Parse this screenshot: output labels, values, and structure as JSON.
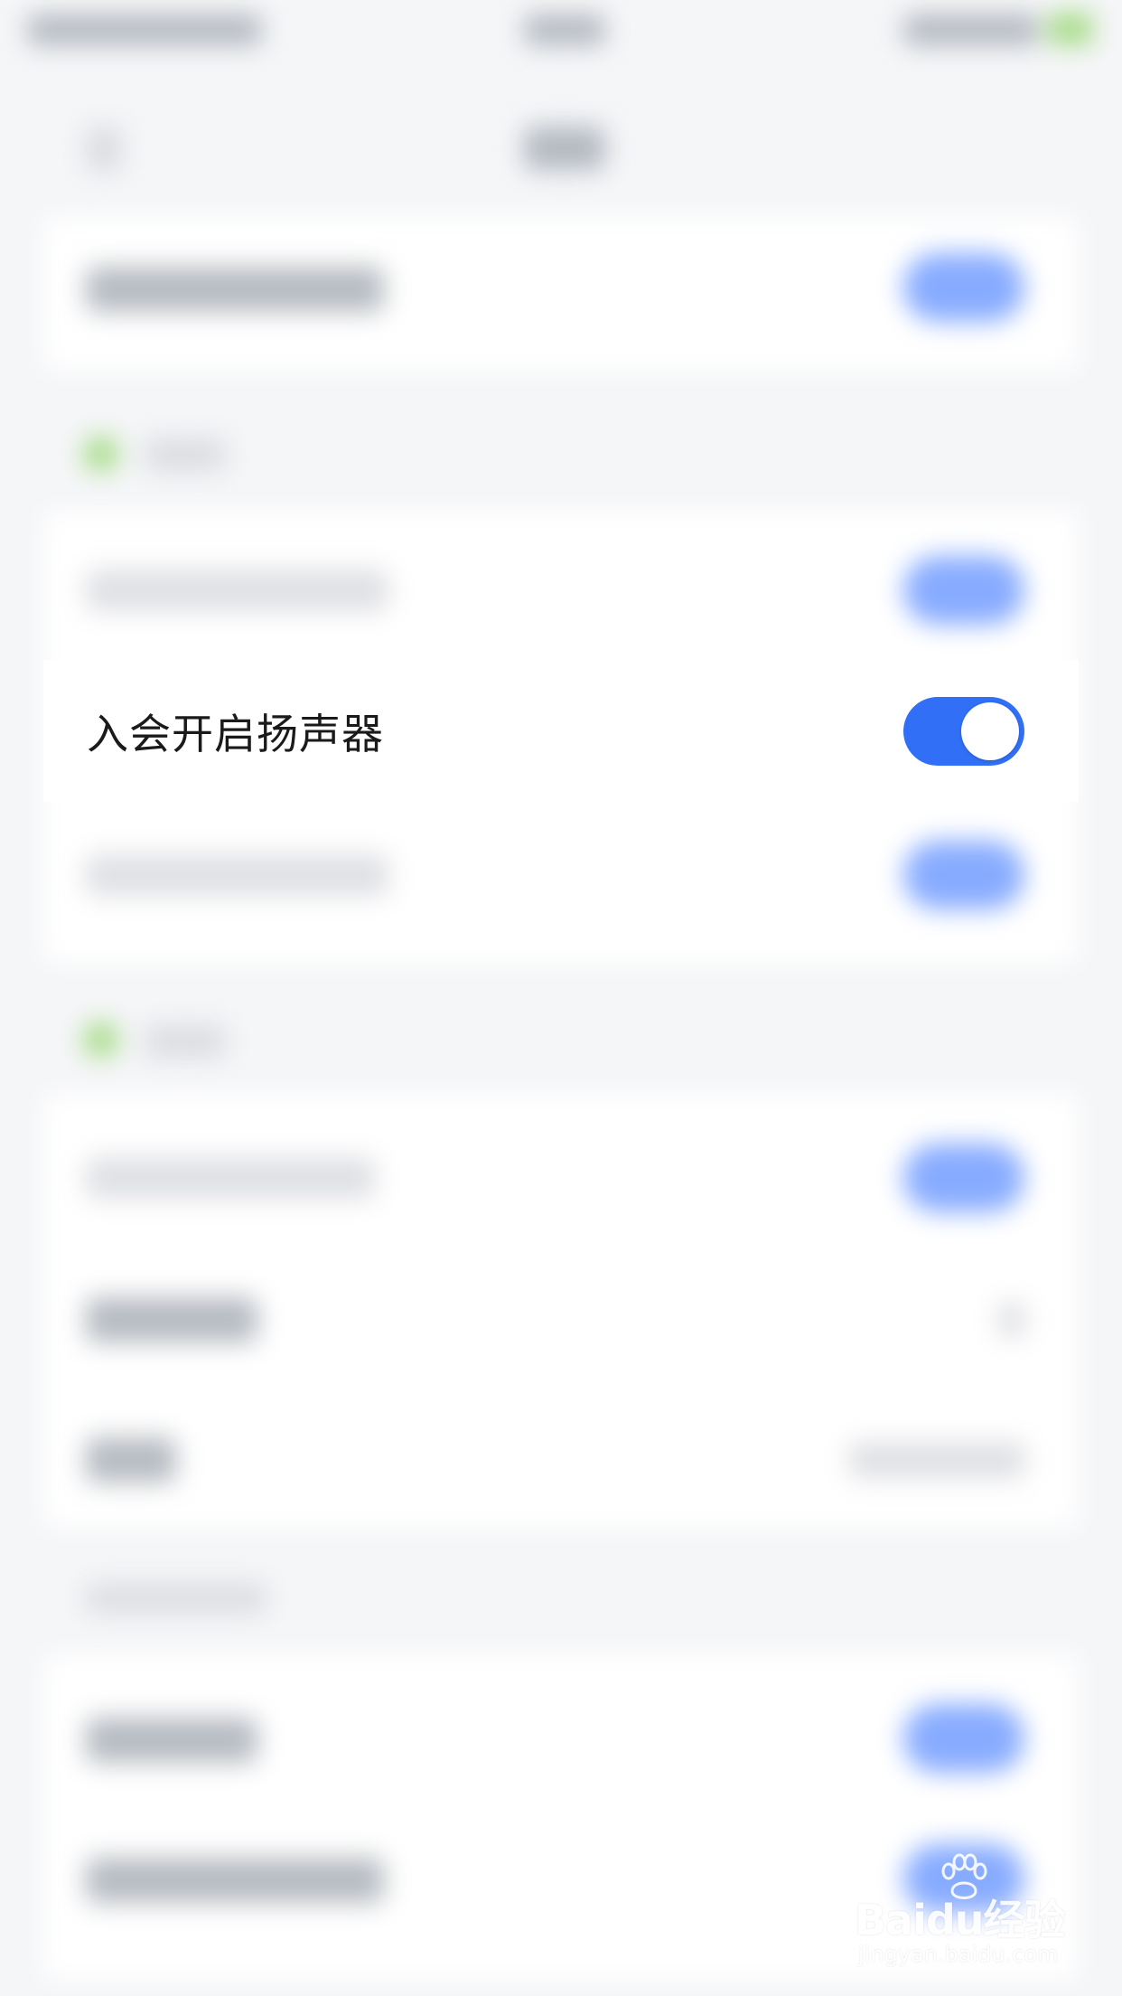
{
  "setting_row": {
    "label": "入会开启扬声器",
    "toggle_on": true
  },
  "watermark": {
    "brand": "Baidu经验",
    "url": "jingyan.baidu.com"
  },
  "colors": {
    "toggle_on": "#306ff6",
    "background": "#f5f6f8"
  }
}
